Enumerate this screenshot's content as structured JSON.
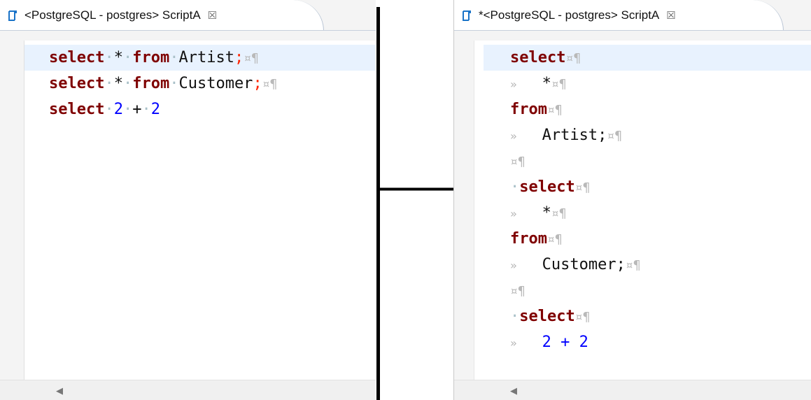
{
  "left_tab": {
    "title": "<PostgreSQL - postgres> ScriptA",
    "close": "☒"
  },
  "right_tab": {
    "title": "*<PostgreSQL - postgres> ScriptA",
    "close": "☒"
  },
  "left_code": [
    [
      "select",
      "*",
      "from",
      "Artist",
      ";"
    ],
    [
      "select",
      "*",
      "from",
      "Customer",
      ";"
    ],
    [
      "select",
      "2",
      "+",
      "2"
    ]
  ],
  "right_code": [
    "select",
    "*",
    "from",
    "Artist;",
    "",
    "select",
    "*",
    "from",
    "Customer;",
    "",
    "select",
    "2 + 2"
  ],
  "glyphs": {
    "space": "·",
    "line_end": "¤¶",
    "tab": "»"
  },
  "colors": {
    "keyword": "#7f0000",
    "number": "#0000ff",
    "semicolon": "#ff2400",
    "current_line": "#e8f2fe",
    "tab_icon": "#1a73c8"
  }
}
